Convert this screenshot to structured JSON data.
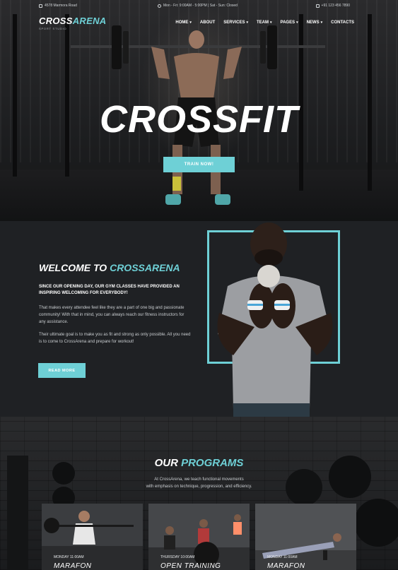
{
  "topbar": {
    "address": "4578 Marmora Road",
    "hours": "Mon - Fri: 9:00AM - 5:00PM  |  Sat - Sun: Closed",
    "phone": "+91 123 456 7890"
  },
  "logo": {
    "part1": "CROSS",
    "part2": "ARENA",
    "tagline": "SPORT STUDIO"
  },
  "nav": {
    "items": [
      {
        "label": "HOME",
        "chevron": "▾"
      },
      {
        "label": "ABOUT",
        "chevron": ""
      },
      {
        "label": "SERVICES",
        "chevron": "▾"
      },
      {
        "label": "TEAM",
        "chevron": "▾"
      },
      {
        "label": "PAGES",
        "chevron": "▾"
      },
      {
        "label": "NEWS",
        "chevron": "▾"
      },
      {
        "label": "CONTACTS",
        "chevron": ""
      }
    ]
  },
  "hero": {
    "title": "CROSSFIT",
    "button": "TRAIN NOW!"
  },
  "welcome": {
    "title_part1": "WELCOME TO",
    "title_part2": "CROSSARENA",
    "lead": "SINCE OUR OPENING DAY, OUR GYM CLASSES HAVE PROVIDED AN INSPIRING WELCOMING FOR EVERYBODY!",
    "para1": "That makes every attendee feel like they are a part of one big and passionate community! With that in mind, you can always reach our fitness instructors for any assistance.",
    "para2": "Their ultimate goal is to make you as fit and strong as only possible. All you need is to come to CrossArena and prepare for workout!",
    "button": "READ MORE"
  },
  "programs": {
    "title_part1": "OUR",
    "title_part2": "PROGRAMS",
    "subtitle_line1": "At CrossArena, we teach functional movements",
    "subtitle_line2": "with emphasis on technique, progression, and efficiency.",
    "cards": [
      {
        "meta": "MONDAY 11:00AM",
        "title": "MARAFON"
      },
      {
        "meta": "THURSDAY 10:00AM",
        "title": "OPEN TRAINING"
      },
      {
        "meta": "MONDAY 11:00AM",
        "title": "MARAFON"
      }
    ]
  },
  "colors": {
    "accent": "#6ed0d6",
    "background": "#1f2124",
    "text": "#ffffff"
  }
}
